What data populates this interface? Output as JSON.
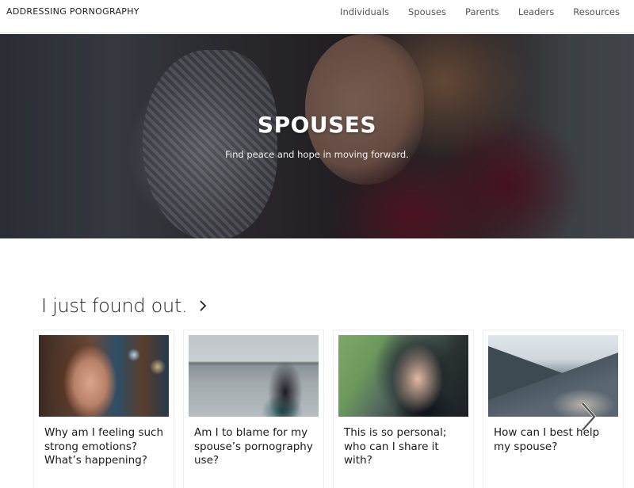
{
  "header": {
    "brand": "ADDRESSING PORNOGRAPHY",
    "nav": [
      "Individuals",
      "Spouses",
      "Parents",
      "Leaders",
      "Resources"
    ]
  },
  "hero": {
    "title": "SPOUSES",
    "subtitle": "Find peace and hope in moving forward."
  },
  "section": {
    "title": "I just found out.",
    "cards": [
      {
        "title": "Why am I feeling such strong emotions? What’s happening?"
      },
      {
        "title": "Am I to blame for my spouse’s pornography use?"
      },
      {
        "title": "This is so personal; who can I share it with?"
      },
      {
        "title": "How can I best help my spouse?"
      }
    ]
  },
  "icons": {
    "section_arrow": "chevron-right-icon",
    "carousel_next": "chevron-right-icon"
  }
}
